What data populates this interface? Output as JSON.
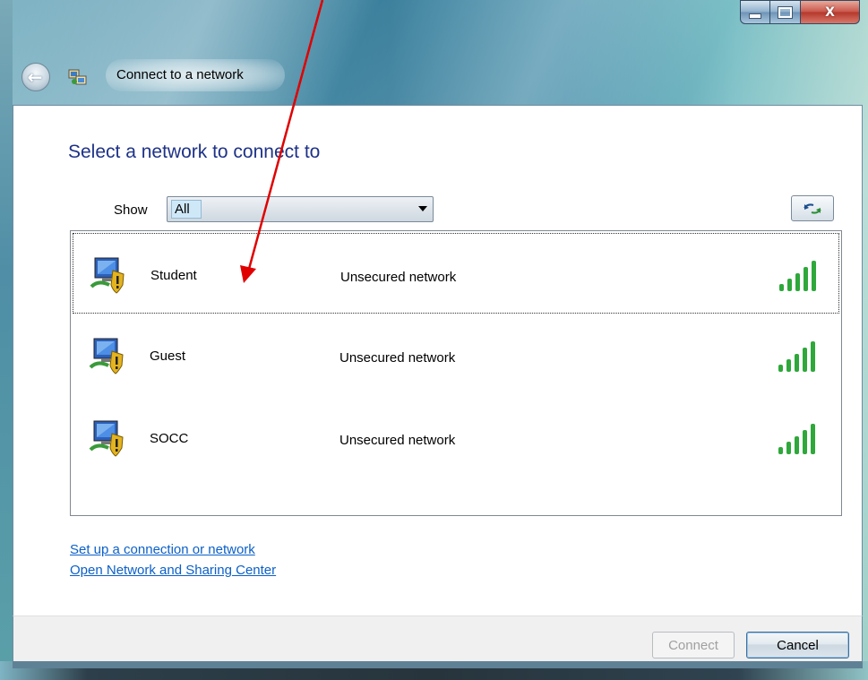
{
  "window": {
    "title": "Connect to a network",
    "caption_buttons": {
      "minimize_icon": "minimize-icon",
      "maximize_icon": "maximize-icon",
      "close_glyph": "X"
    }
  },
  "heading": "Select a network to connect to",
  "filter": {
    "label": "Show",
    "selected": "All"
  },
  "refresh_icon": "refresh-icon",
  "networks": [
    {
      "name": "Student",
      "security": "Unsecured network",
      "signal_bars": 5,
      "focused": true
    },
    {
      "name": "Guest",
      "security": "Unsecured network",
      "signal_bars": 5,
      "focused": false
    },
    {
      "name": "SOCC",
      "security": "Unsecured network",
      "signal_bars": 5,
      "focused": false
    }
  ],
  "links": {
    "setup": "Set up a connection or network",
    "sharing_center": "Open Network and Sharing Center"
  },
  "buttons": {
    "connect": "Connect",
    "cancel": "Cancel"
  },
  "colors": {
    "heading": "#1e3287",
    "link": "#0b60c8",
    "signal": "#2ea83a",
    "annotation_arrow": "#e00000"
  }
}
